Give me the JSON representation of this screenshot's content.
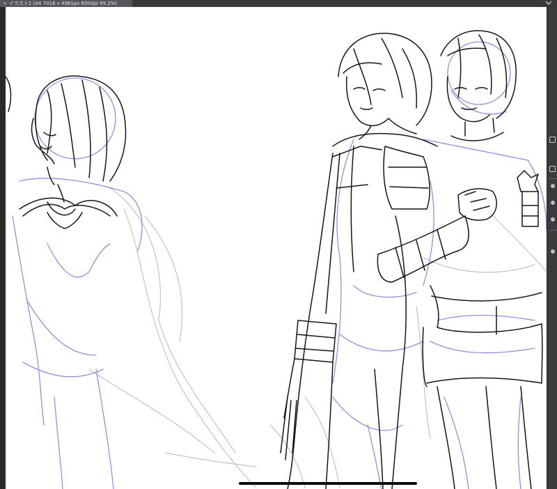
{
  "document_tab": {
    "close_glyph": "×",
    "title": "イラスト2 (A4 7016 x 4961px 600dpi 99.2%)",
    "menu_icon": "chevron-down-icon"
  },
  "canvas": {
    "background": "#ffffff",
    "sketch_line_color": "#111111",
    "rough_line_color": "#8c8fe0",
    "faint_line_color": "#b9b6c6"
  },
  "right_panel": {
    "icons": [
      "square-icon",
      "square-icon",
      "eye-icon",
      "eye-icon",
      "eye-icon",
      "eye-icon"
    ]
  },
  "colors": {
    "app_background": "#2f2f31",
    "tab_background": "#55565b",
    "home_indicator": "#0c0c0c"
  }
}
